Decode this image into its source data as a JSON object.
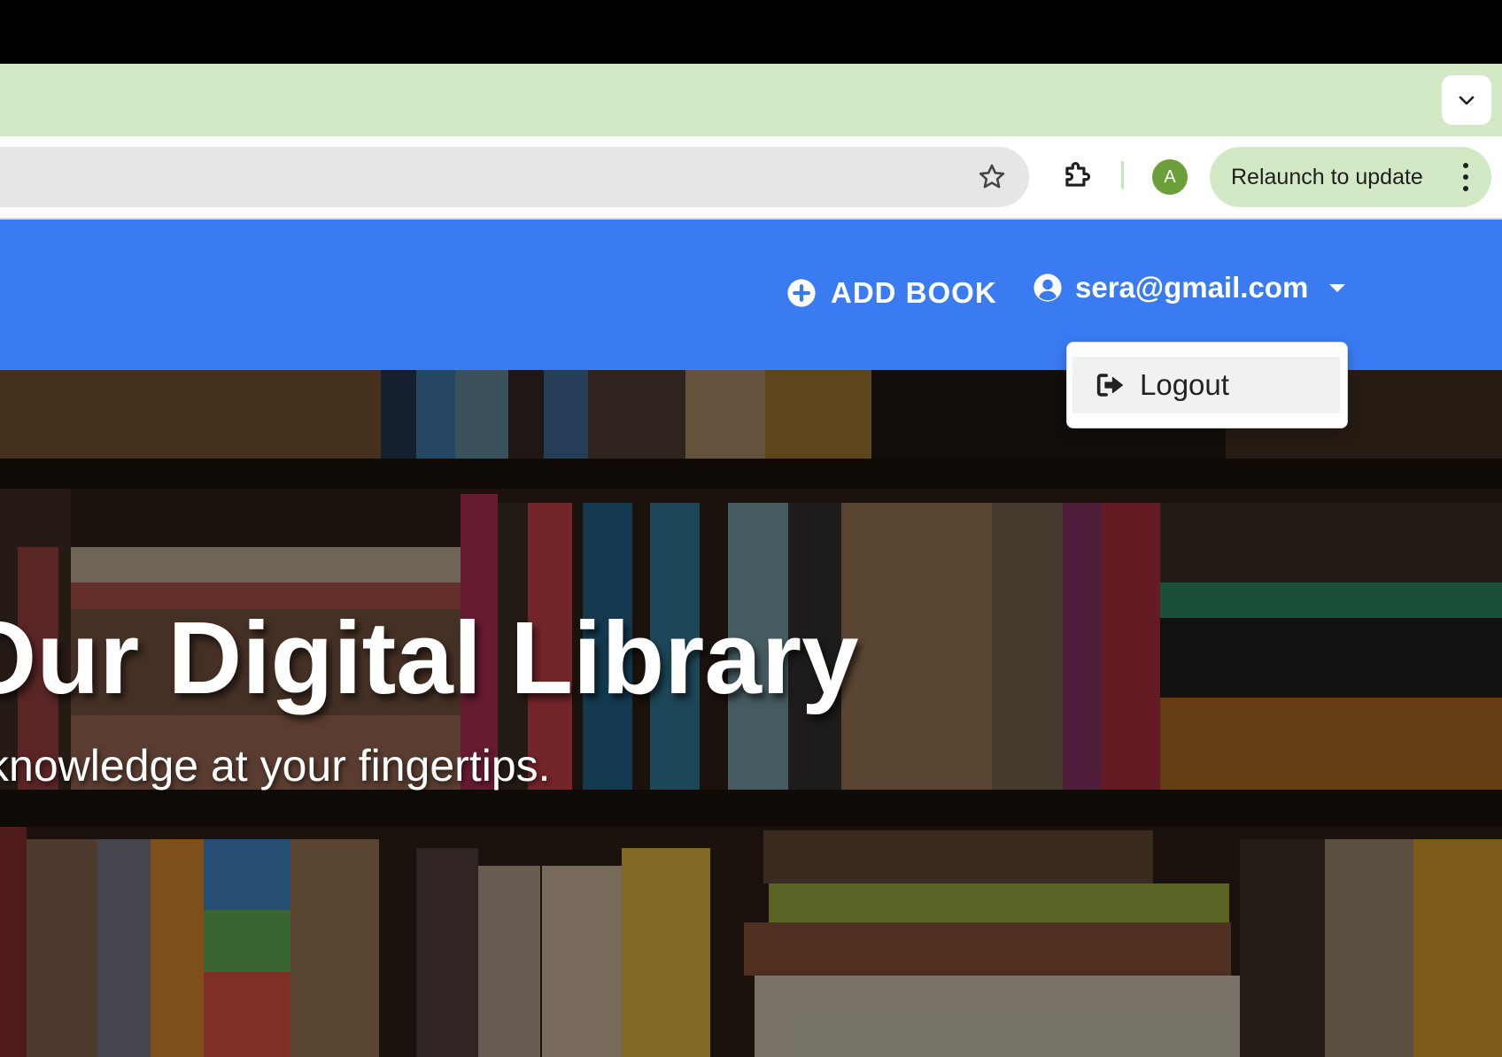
{
  "browser": {
    "profile_initial": "A",
    "relaunch_label": "Relaunch to update",
    "tabstrip_color": "#d3e9c5",
    "icons": [
      "chevron-down-icon",
      "star-icon",
      "puzzle-icon",
      "more-vert-icon"
    ]
  },
  "navbar": {
    "background": "#3a7bf1",
    "add_book_label": "ADD BOOK",
    "user_email": "sera@gmail.com",
    "icons": [
      "plus-circle-icon",
      "user-circle-icon",
      "caret-down-icon"
    ]
  },
  "dropdown": {
    "items": [
      {
        "label": "Logout",
        "icon": "logout-icon"
      }
    ]
  },
  "hero": {
    "title": "o Our Digital Library",
    "subtitle": "rld of knowledge at your fingertips."
  }
}
